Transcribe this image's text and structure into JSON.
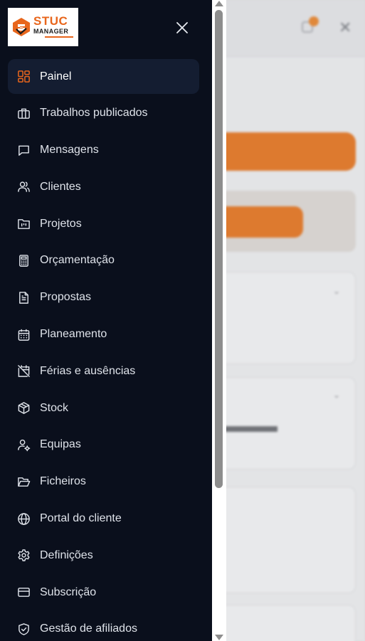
{
  "app": {
    "logo_text_top": "STUC",
    "logo_text_bottom": "MANAGER",
    "accent_color": "#e8661c",
    "drawer_bg": "#0a0f1c"
  },
  "drawer": {
    "close_icon": "close-icon",
    "items": [
      {
        "label": "Painel",
        "icon": "dashboard-grid-icon",
        "active": true
      },
      {
        "label": "Trabalhos publicados",
        "icon": "briefcase-icon",
        "active": false
      },
      {
        "label": "Mensagens",
        "icon": "message-square-icon",
        "active": false
      },
      {
        "label": "Clientes",
        "icon": "users-icon",
        "active": false
      },
      {
        "label": "Projetos",
        "icon": "folder-kanban-icon",
        "active": false
      },
      {
        "label": "Orçamentação",
        "icon": "calculator-icon",
        "active": false
      },
      {
        "label": "Propostas",
        "icon": "file-text-icon",
        "active": false
      },
      {
        "label": "Planeamento",
        "icon": "calendar-icon",
        "active": false
      },
      {
        "label": "Férias e ausências",
        "icon": "calendar-off-icon",
        "active": false
      },
      {
        "label": "Stock",
        "icon": "package-icon",
        "active": false
      },
      {
        "label": "Equipas",
        "icon": "user-cog-icon",
        "active": false
      },
      {
        "label": "Ficheiros",
        "icon": "folder-open-icon",
        "active": false
      },
      {
        "label": "Portal do cliente",
        "icon": "globe-icon",
        "active": false
      },
      {
        "label": "Definições",
        "icon": "gear-icon",
        "active": false
      },
      {
        "label": "Subscrição",
        "icon": "credit-card-icon",
        "active": false
      },
      {
        "label": "Gestão de afiliados",
        "icon": "shield-check-icon",
        "active": false
      }
    ]
  }
}
